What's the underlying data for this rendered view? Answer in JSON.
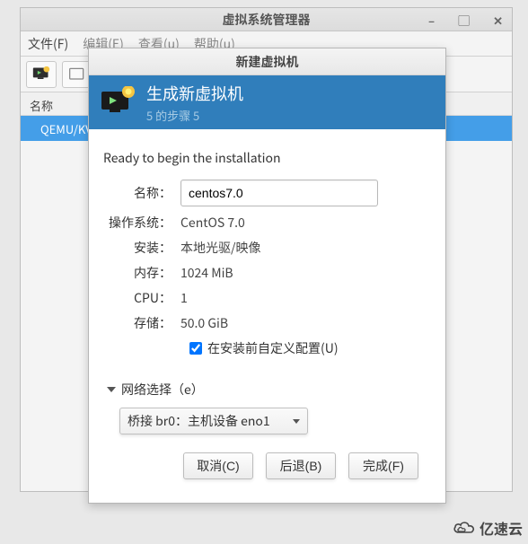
{
  "main_window": {
    "title": "虚拟系统管理器",
    "menu": {
      "file": "文件(F)",
      "edit": "编辑(E)",
      "view": "查看(u)",
      "help": "帮助(u)"
    },
    "column_header": "名称",
    "vm_row": "QEMU/KV"
  },
  "dialog": {
    "title": "新建虚拟机",
    "header_line1": "生成新虚拟机",
    "header_line2": "5 的步骤 5",
    "intro": "Ready to begin the installation",
    "labels": {
      "name": "名称：",
      "os": "操作系统：",
      "install": "安装：",
      "memory": "内存：",
      "cpu": "CPU：",
      "storage": "存储："
    },
    "values": {
      "name": "centos7.0",
      "os": "CentOS 7.0",
      "install": "本地光驱/映像",
      "memory": "1024 MiB",
      "cpu": "1",
      "storage": "50.0 GiB"
    },
    "customize_checked": true,
    "customize_label": "在安装前自定义配置(U)",
    "network_expand_label": "网络选择（e）",
    "network_combo": "桥接 br0：主机设备 eno1",
    "buttons": {
      "cancel": "取消(C)",
      "back": "后退(B)",
      "finish": "完成(F)"
    }
  },
  "watermark": "亿速云"
}
